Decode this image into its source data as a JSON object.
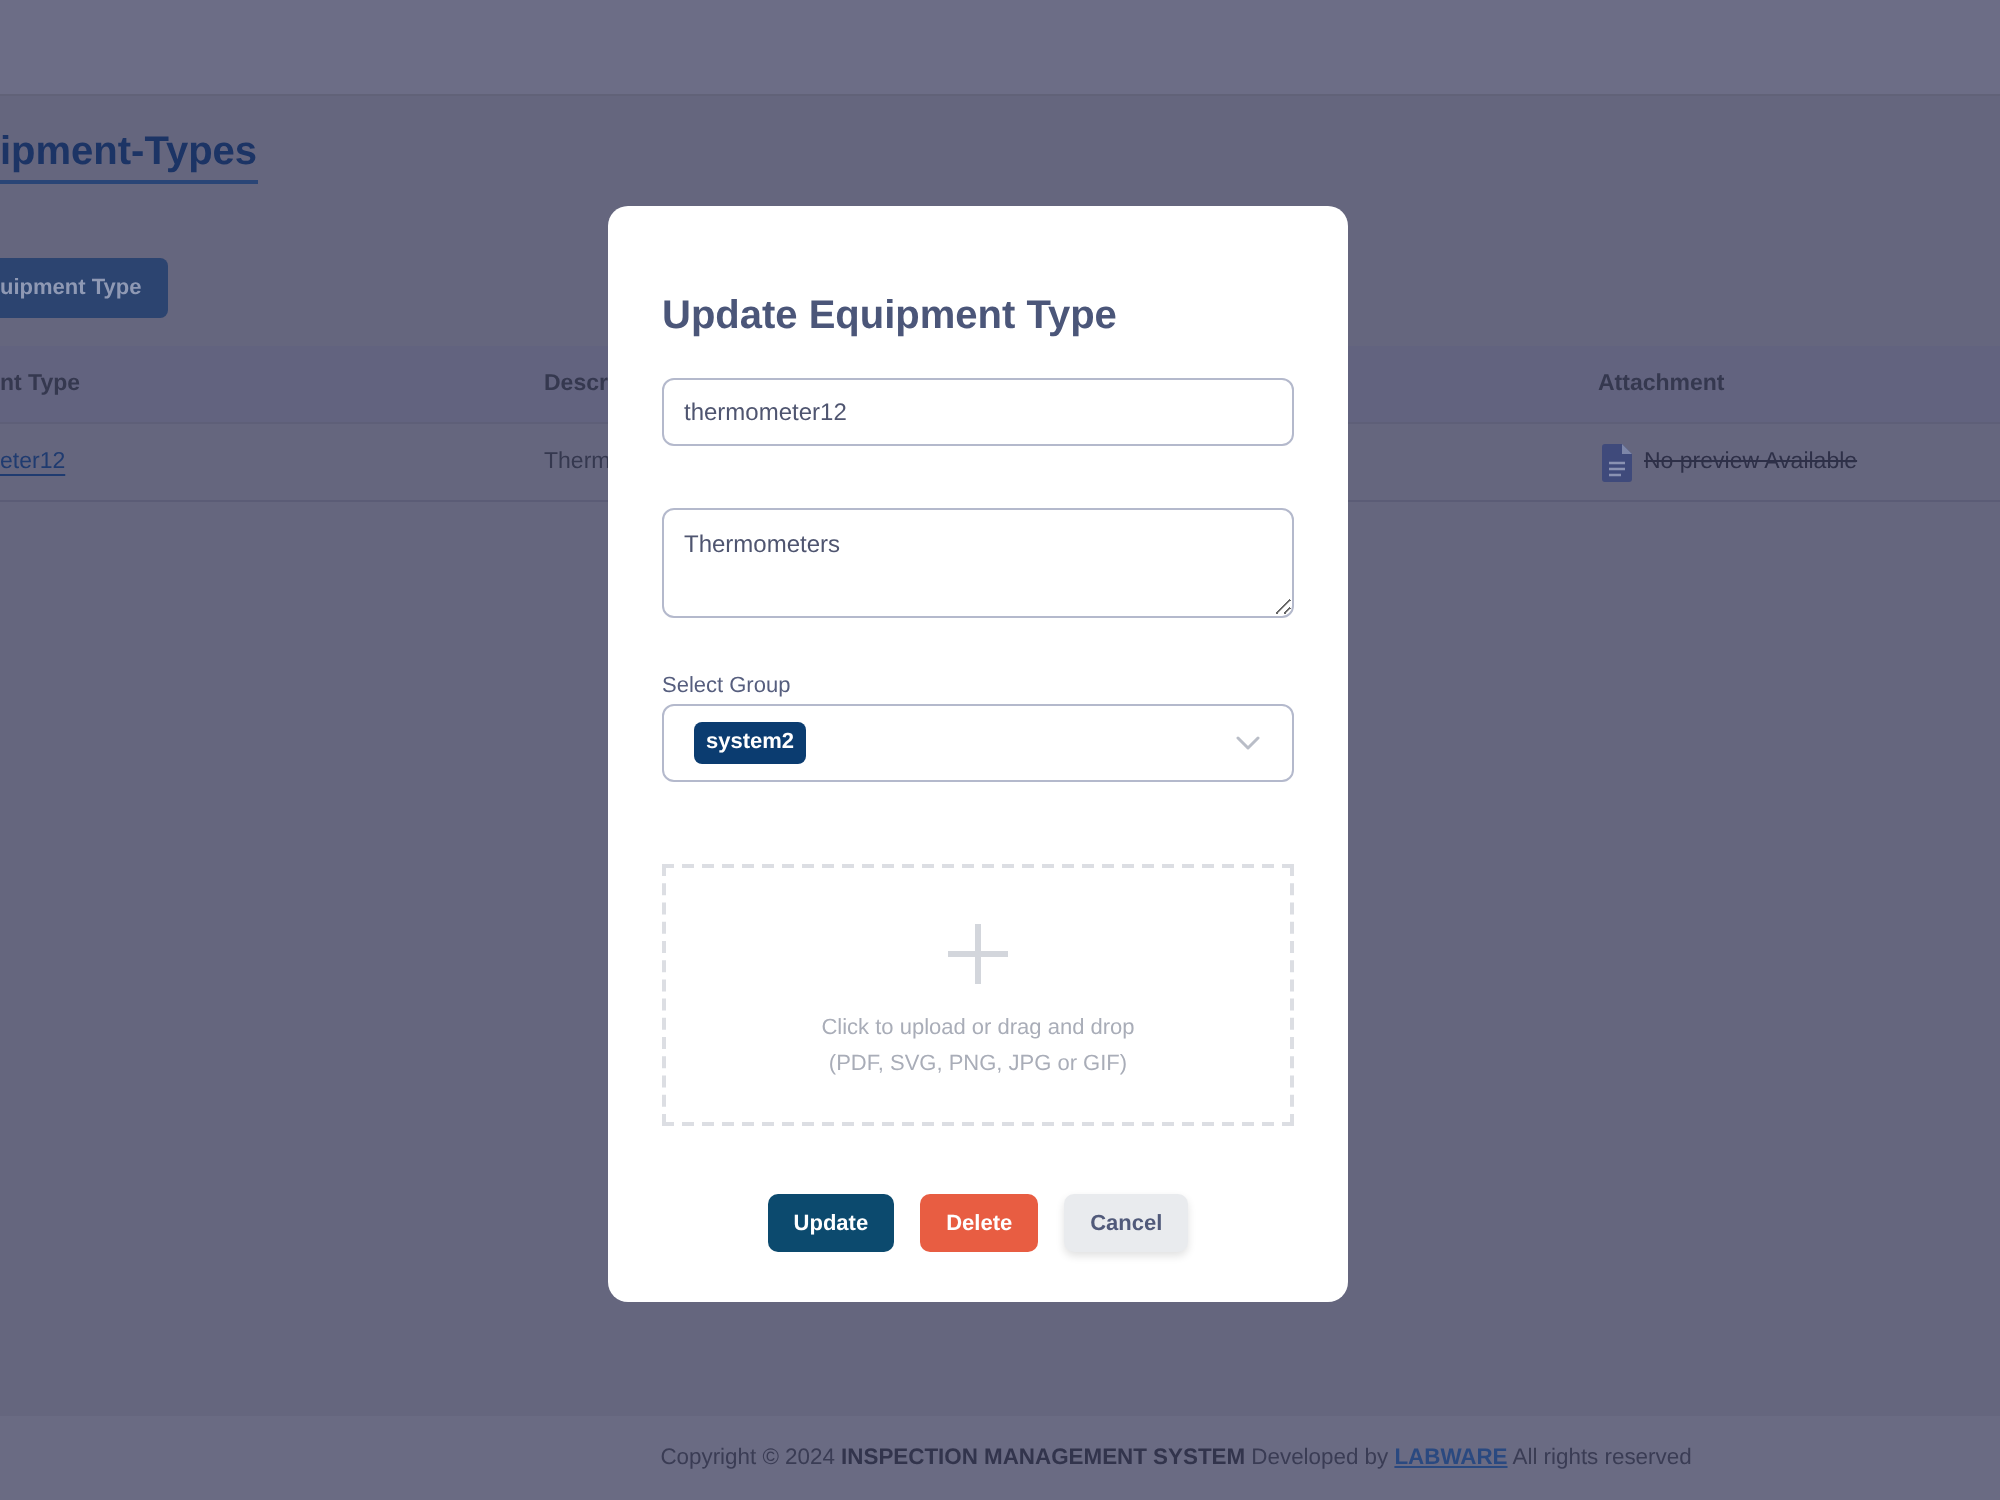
{
  "page": {
    "title": "ipment-Types",
    "add_button": "uipment Type"
  },
  "table": {
    "columns": [
      "nt Type",
      "Descr",
      "Attachment"
    ],
    "rows": [
      {
        "cells": [
          "eter12",
          "Therm"
        ],
        "attachment": "No preview Available"
      }
    ]
  },
  "modal": {
    "title": "Update Equipment Type",
    "fields": [
      {
        "kind": "input",
        "value": "thermometer12"
      },
      {
        "kind": "textarea",
        "value": "Thermometers"
      },
      {
        "kind": "select",
        "label": "Select Group",
        "chips": [
          "system2"
        ]
      }
    ],
    "upload": {
      "lines": [
        "Click to upload or drag and drop",
        "(PDF, SVG, PNG, JPG or GIF)"
      ]
    },
    "buttons": [
      {
        "kind": "primary",
        "label": "Update"
      },
      {
        "kind": "danger",
        "label": "Delete"
      },
      {
        "kind": "secondary",
        "label": "Cancel"
      }
    ]
  },
  "footer": {
    "text": "Copyright © 2024 **INSPECTION MANAGEMENT SYSTEM** Developed by",
    "link": "LABWARE",
    "text_after": "All rights reserved"
  }
}
